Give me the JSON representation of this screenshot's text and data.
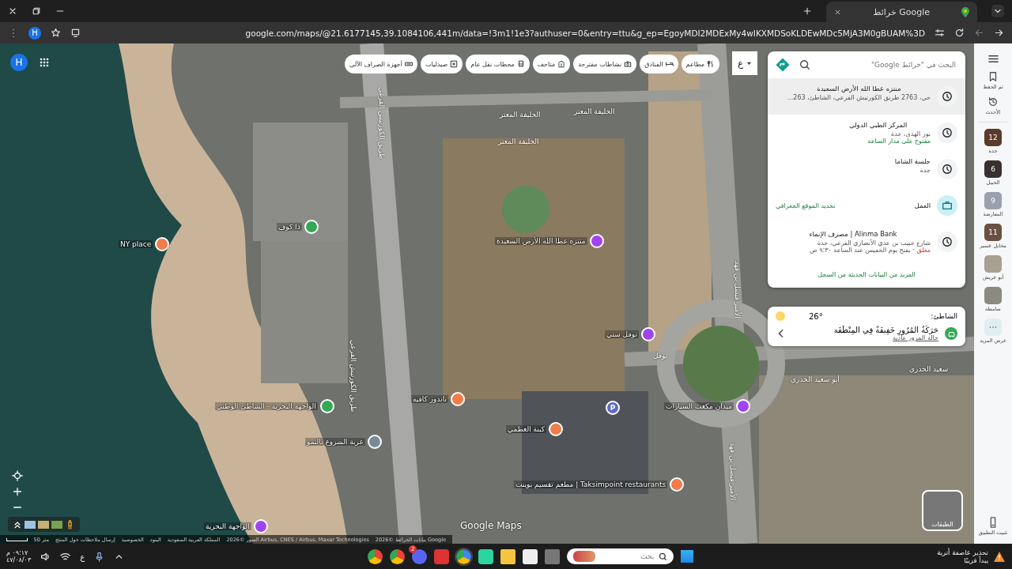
{
  "browser": {
    "tab_title": "خرائط Google",
    "url": "google.com/maps/@21.6177145,39.1084106,441m/data=!3m1!1e3?authuser=0&entry=ttu&g_ep=EgoyMDI2MDExMy4wIKXMDSoKLDEwMDc5MjA3M0gBUAM%3D",
    "profile_initial": "H"
  },
  "map": {
    "account_initial": "H",
    "labels": [
      {
        "text": "NY place",
        "kind": "pin",
        "color": "#f07c4a"
      },
      {
        "text": "ذا كوف",
        "kind": "pin",
        "color": "#34a853"
      },
      {
        "text": "منتزه عطا الله الأرض السعيدة",
        "kind": "pin",
        "color": "#a142f4"
      },
      {
        "text": "نوفل ستي",
        "kind": "pin",
        "color": "#a142f4"
      },
      {
        "text": "ناندوز كافيه",
        "kind": "pin",
        "color": "#f07c4a"
      },
      {
        "text": "كبنة العظمي",
        "kind": "pin",
        "color": "#f07c4a"
      },
      {
        "text": "مطعم تقسيم بوينت | Taksimpoint restaurants",
        "kind": "pin",
        "color": "#f07c4a"
      },
      {
        "text": "ميدان مكعب السيارات",
        "kind": "pin",
        "color": "#a142f4"
      },
      {
        "text": "الواجهة البحرية - الشاطئ الوطني",
        "kind": "pin",
        "color": "#34a853"
      },
      {
        "text": "عربة الشروع بالنمو",
        "kind": "pin",
        "color": "#7b8a9a"
      },
      {
        "text": "الواجهة البحرية",
        "kind": "pin",
        "color": "#a142f4"
      },
      {
        "text": "P",
        "kind": "parking",
        "color": "#5c6bc0"
      },
      {
        "text": "الخليفة المعتز",
        "kind": "street"
      },
      {
        "text": "الخليفة المعتز",
        "kind": "street"
      },
      {
        "text": "الخليفة المعتز",
        "kind": "street"
      },
      {
        "text": "طريق الكورنيش الفرعي",
        "kind": "vstreet"
      },
      {
        "text": "طريق الكورنيش الفرعي",
        "kind": "vstreet"
      },
      {
        "text": "الأمير فيصل بن فهد",
        "kind": "vstreet"
      },
      {
        "text": "الأمير فيصل بن فهد",
        "kind": "vstreet"
      },
      {
        "text": "نوفل",
        "kind": "street"
      },
      {
        "text": "أبو سعيد الخدري",
        "kind": "street"
      },
      {
        "text": "سعيد الخدري",
        "kind": "street"
      }
    ],
    "scale": "50 متر",
    "attribution": [
      "بيانات الخرائط ©2026 Google",
      "الصور ©2026 Airbus, CNES / Airbus, Maxar Technologies",
      "المملكة العربية السعودية",
      "البنود",
      "الخصوصية",
      "إرسال ملاحظات حول المنتج"
    ],
    "brand": "Google Maps",
    "layers": "الطبقات"
  },
  "categories": [
    {
      "label": "مطاعم",
      "kind": "food"
    },
    {
      "label": "الفنادق",
      "kind": "hotel"
    },
    {
      "label": "نشاطات مقترحة",
      "kind": "camera"
    },
    {
      "label": "متاحف",
      "kind": "museum"
    },
    {
      "label": "محطات نقل عام",
      "kind": "transit"
    },
    {
      "label": "صيدليات",
      "kind": "pharmacy"
    },
    {
      "label": "أجهزة الصراف الآلي",
      "kind": "atm"
    }
  ],
  "language_button": "ع",
  "search": {
    "placeholder": "البحث في \"خرائط Google\""
  },
  "history": [
    {
      "title": "منتزه عطا الله الأرض السعيدة",
      "hovered": true,
      "lines": [
        "حي، 2763 طريق الكورنيش الفرعي، الشاطئ، 263..."
      ]
    },
    {
      "title": "المركز الطبي الدولي",
      "hovered": false,
      "lines": [
        "نور الهدى، جدة"
      ],
      "status": {
        "text": "مفتوح على مدار الساعة",
        "open": true
      }
    },
    {
      "title": "جلسة الشاما",
      "hovered": false,
      "lines": [
        "جدة"
      ]
    }
  ],
  "home": {
    "label": "العمل",
    "action": "تحديد الموقع الجغرافي"
  },
  "history_more": [
    {
      "title": "Alinma Bank | مصرف الإنماء",
      "hovered": false,
      "lines": [
        "شارع خبيب بن عدي الأنصاري الفرعي، جدة"
      ],
      "status": {
        "text": "مغلق",
        "open": false,
        "note": "· يفتح يوم الخميس عند الساعة ٩:٣٠ ص"
      }
    }
  ],
  "more_link": "المزيد من البيانات الحديثة من السجل",
  "weather": {
    "place": "الشاطئ:",
    "temperature": "26°",
    "traffic_title": "حَرَكَةُ المُرُورِ خَفِيفَةٌ فِي المِنْطَقَة",
    "traffic_link": "حالة المرور عادية"
  },
  "sidebar": [
    {
      "label": "تم الحفظ",
      "kind": "saved"
    },
    {
      "label": "الأحدث",
      "kind": "recent"
    },
    {
      "label": "جدة",
      "kind": "place",
      "badge": "12",
      "color": "#5a3a2a"
    },
    {
      "label": "الحبيل",
      "kind": "place",
      "badge": "6",
      "color": "#3a3030"
    },
    {
      "label": "المعارضة",
      "kind": "place",
      "badge": "9",
      "color": "#9aa0b0"
    },
    {
      "label": "محايل عسير",
      "kind": "place",
      "badge": "11",
      "color": "#6a5040"
    },
    {
      "label": "أبو عريش",
      "kind": "place",
      "color": "#a8a090"
    },
    {
      "label": "صامطة",
      "kind": "place",
      "color": "#8a8a80"
    },
    {
      "label": "عرض المزيد",
      "kind": "more"
    }
  ],
  "sidebar_bottom": "تثبيت التطبيق",
  "taskbar": {
    "time": "٠٩:١٧ م",
    "date": "٤٧/٠٨/٠٣",
    "language": "ع",
    "search_placeholder": "بحث",
    "alert_title": "تحذير عاصفة أتربة",
    "alert_subtitle": "يبدأ قريبًا",
    "discord_badge": "2"
  }
}
